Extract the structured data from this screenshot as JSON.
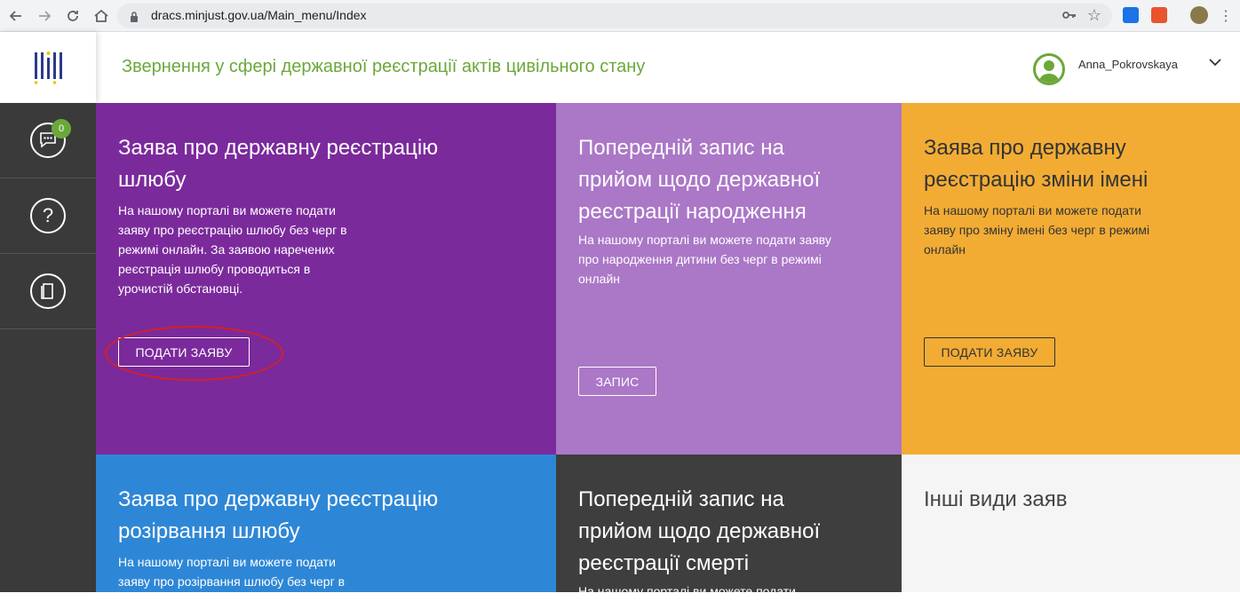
{
  "browser": {
    "url": "dracs.minjust.gov.ua/Main_menu/Index"
  },
  "header": {
    "title": "Звернення у сфері державної реєстрації актів цивільного стану",
    "username": "Anna_Pokrovskaya"
  },
  "sidebar": {
    "messages_badge": "0",
    "help_symbol": "?"
  },
  "tiles": [
    {
      "title": "Заява про державну реєстрацію шлюбу",
      "description": "На нашому порталі ви можете подати заяву про реєстрацію шлюбу без черг в режимі онлайн. За заявою наречених реєстрація шлюбу проводиться в урочистій обстановці.",
      "button": "ПОДАТИ ЗАЯВУ"
    },
    {
      "title": "Попередній запис на прийом щодо державної реєстрації народження",
      "description": "На нашому порталі ви можете подати заяву про народження дитини без черг в режимі онлайн",
      "button": "ЗАПИС"
    },
    {
      "title": "Заява про державну реєстрацію зміни імені",
      "description": "На нашому порталі ви можете подати заяву про зміну імені без черг в режимі онлайн",
      "button": "ПОДАТИ ЗАЯВУ"
    },
    {
      "title": "Заява про державну реєстрацію розірвання шлюбу",
      "description": "На нашому порталі ви можете подати заяву про розірвання шлюбу без черг в"
    },
    {
      "title": "Попередній запис на прийом щодо державної реєстрації смерті",
      "description": "На нашому порталі ви можете подати"
    },
    {
      "title": "Інші види заяв"
    }
  ],
  "colors": {
    "purple": "#7b2a9c",
    "lilac": "#ab77c7",
    "orange": "#f2ac34",
    "blue": "#2e87d6",
    "dark": "#3e3e3e",
    "light": "#f5f5f5",
    "accent_green": "#6ba83a",
    "annotation_red": "#d42121"
  }
}
